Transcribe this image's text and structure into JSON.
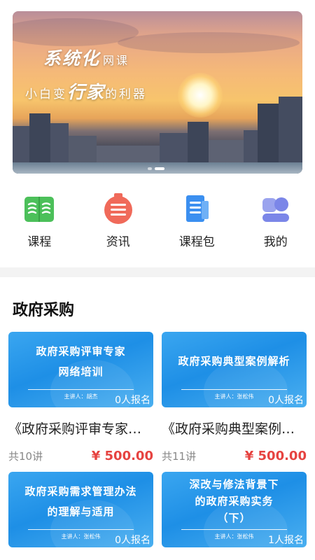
{
  "banner": {
    "line1_big": "系统化",
    "line1_small": "网课",
    "line2_a": "小白变",
    "line2_big": "行家",
    "line2_b": "的利器"
  },
  "nav": {
    "items": [
      {
        "label": "课程",
        "icon": "book-icon",
        "color": "#4cc05a"
      },
      {
        "label": "资讯",
        "icon": "news-icon",
        "color": "#f06a5a"
      },
      {
        "label": "课程包",
        "icon": "document-icon",
        "color": "#3b8ff0"
      },
      {
        "label": "我的",
        "icon": "user-icon",
        "color": "#7b86e8"
      }
    ]
  },
  "section": {
    "title": "政府采购"
  },
  "courses": [
    {
      "thumb_title": "政府采购评审专家\n网络培训",
      "lecturer": "主讲人：胡杰",
      "enrolled": "0人报名",
      "title": "《政府采购评审专家网络培训》",
      "lessons": "共10讲",
      "price": "¥ 500.00"
    },
    {
      "thumb_title": "政府采购典型案例解析",
      "lecturer": "主讲人：张松伟",
      "enrolled": "0人报名",
      "title": "《政府采购典型案例解析》",
      "lessons": "共11讲",
      "price": "¥ 500.00"
    },
    {
      "thumb_title": "政府采购需求管理办法\n的理解与适用",
      "lecturer": "主讲人：张松伟",
      "enrolled": "0人报名"
    },
    {
      "thumb_title": "深改与修法背景下\n的政府采购实务\n（下）",
      "lecturer": "主讲人：张松伟",
      "enrolled": "1人报名"
    }
  ]
}
